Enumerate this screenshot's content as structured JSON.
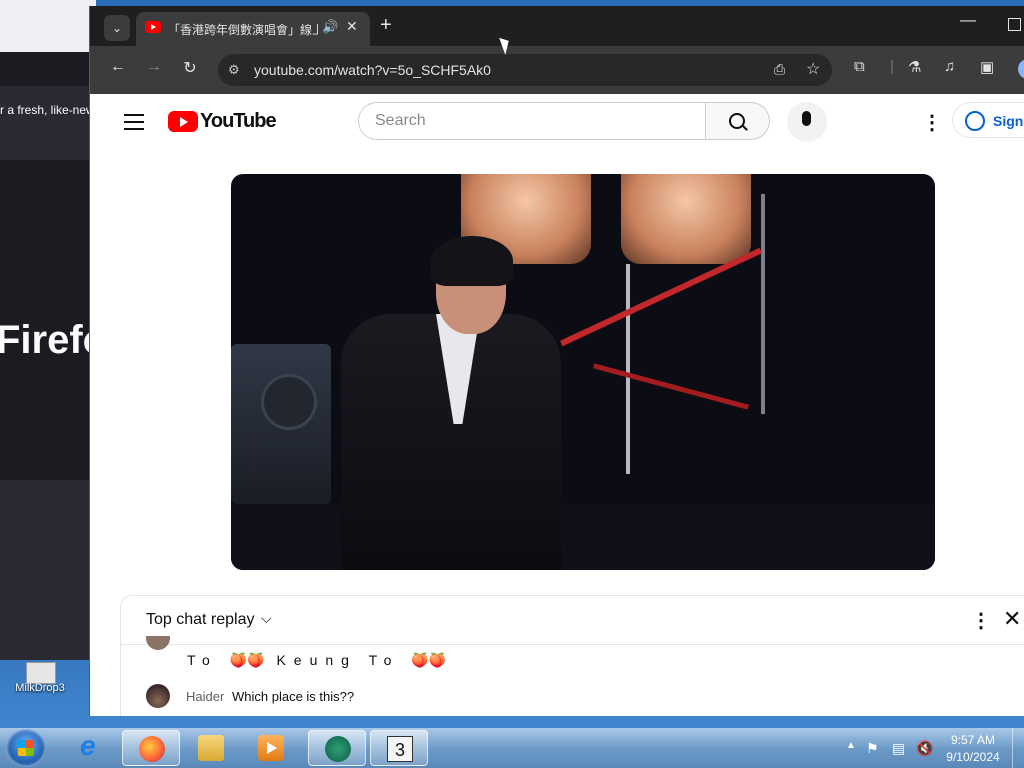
{
  "background_window": {
    "notice_text": "r a fresh, like-new",
    "brand_text": "Firefo"
  },
  "desktop": {
    "icon_label": "MilkDrop3"
  },
  "browser": {
    "tab": {
      "title": "「香港跨年倒數演唱會」線上",
      "close_glyph": "✕",
      "audio_glyph": "🔊"
    },
    "new_tab_glyph": "+",
    "minimize_glyph": "—",
    "back_glyph": "←",
    "forward_glyph": "→",
    "reload_glyph": "↻",
    "address": {
      "url": "youtube.com/watch?v=5o_SCHF5Ak0",
      "site_info_glyph": "⚙"
    },
    "toolbar_icons": [
      "install-icon",
      "bookmark-star-icon",
      "extensions-icon",
      "labs-icon",
      "media-controls-icon",
      "side-panel-icon",
      "profile-icon"
    ]
  },
  "youtube": {
    "logo_text": "YouTube",
    "search": {
      "placeholder": "Search",
      "value": ""
    },
    "more_glyph": "⋮",
    "sign_in_label": "Sign"
  },
  "chat": {
    "title": "Top chat replay",
    "chevron_glyph": "⌵",
    "more_glyph": "⋮",
    "close_glyph": "✕",
    "message_1": {
      "text_a": "To",
      "emoji_a": "🍑🍑",
      "text_b": "Keung",
      "text_c": "To",
      "emoji_b": "🍑🍑"
    },
    "message_2": {
      "author": "Haider",
      "text": "Which place is this??"
    }
  },
  "taskbar": {
    "apps": [
      "start-button",
      "internet-explorer",
      "firefox",
      "windows-explorer",
      "windows-media-player",
      "chrome",
      "milkdrop3"
    ],
    "milkdrop_glyph": "3",
    "clock": {
      "time": "9:57 AM",
      "date": "9/10/2024"
    }
  }
}
